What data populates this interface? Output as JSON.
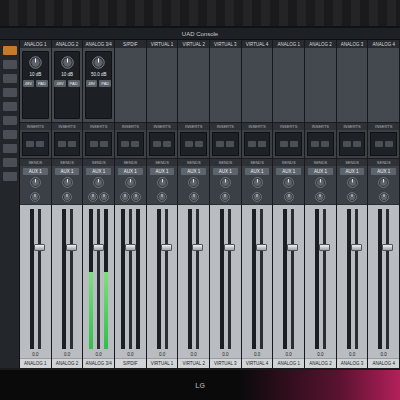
{
  "window": {
    "title": "UAD Console"
  },
  "brand": "LG",
  "labels": {
    "inserts": "INSERTS",
    "sends": "SENDS"
  },
  "channels": [
    {
      "name": "ANALOG 1",
      "kind": "preamp",
      "gain": "10 dB",
      "buttons": [
        "48V",
        "PAD"
      ],
      "send": "AUX 1",
      "stereo": false,
      "fader": 0.72,
      "meter": 0.0,
      "reading": "0.0"
    },
    {
      "name": "ANALOG 2",
      "kind": "preamp",
      "gain": "10 dB",
      "buttons": [
        "48V",
        "PAD"
      ],
      "send": "AUX 1",
      "stereo": false,
      "fader": 0.72,
      "meter": 0.0,
      "reading": "0.0"
    },
    {
      "name": "ANALOG 3/4",
      "kind": "preamp",
      "gain": "50.0 dB",
      "buttons": [
        "48V",
        "PAD"
      ],
      "send": "AUX 1",
      "stereo": true,
      "fader": 0.72,
      "meter": 0.55,
      "reading": "0.0"
    },
    {
      "name": "S/PDIF",
      "kind": "plain",
      "gain": "",
      "buttons": [],
      "send": "AUX 1",
      "stereo": true,
      "fader": 0.72,
      "meter": 0.0,
      "reading": "0.0"
    },
    {
      "name": "VIRTUAL 1",
      "kind": "plain",
      "gain": "",
      "buttons": [],
      "send": "AUX 1",
      "stereo": false,
      "fader": 0.72,
      "meter": 0.0,
      "reading": "0.0"
    },
    {
      "name": "VIRTUAL 2",
      "kind": "plain",
      "gain": "",
      "buttons": [],
      "send": "AUX 1",
      "stereo": false,
      "fader": 0.72,
      "meter": 0.0,
      "reading": "0.0"
    },
    {
      "name": "VIRTUAL 3",
      "kind": "plain",
      "gain": "",
      "buttons": [],
      "send": "AUX 1",
      "stereo": false,
      "fader": 0.72,
      "meter": 0.0,
      "reading": "0.0"
    },
    {
      "name": "VIRTUAL 4",
      "kind": "plain",
      "gain": "",
      "buttons": [],
      "send": "AUX 1",
      "stereo": false,
      "fader": 0.72,
      "meter": 0.0,
      "reading": "0.0"
    },
    {
      "name": "ANALOG 1",
      "kind": "plain",
      "gain": "",
      "buttons": [],
      "send": "AUX 1",
      "stereo": false,
      "fader": 0.72,
      "meter": 0.0,
      "reading": "0.0"
    },
    {
      "name": "ANALOG 2",
      "kind": "plain",
      "gain": "",
      "buttons": [],
      "send": "AUX 1",
      "stereo": false,
      "fader": 0.72,
      "meter": 0.0,
      "reading": "0.0"
    },
    {
      "name": "ANALOG 3",
      "kind": "plain",
      "gain": "",
      "buttons": [],
      "send": "AUX 1",
      "stereo": false,
      "fader": 0.72,
      "meter": 0.0,
      "reading": "0.0"
    },
    {
      "name": "ANALOG 4",
      "kind": "plain",
      "gain": "",
      "buttons": [],
      "send": "AUX 1",
      "stereo": false,
      "fader": 0.72,
      "meter": 0.0,
      "reading": "0.0"
    }
  ]
}
